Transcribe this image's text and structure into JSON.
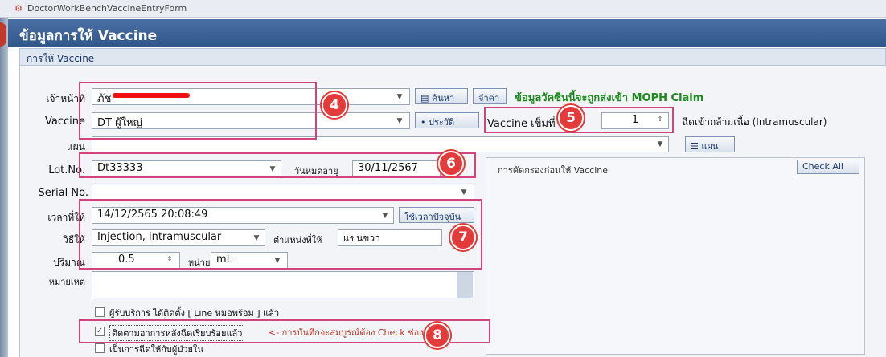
{
  "window": {
    "title": "DoctorWorkBenchVaccineEntryForm"
  },
  "header": {
    "title": "ข้อมูลการให้ Vaccine"
  },
  "section": {
    "title": "การให้ Vaccine"
  },
  "form": {
    "officer_label": "เจ้าหน้าที่",
    "officer_value": "ภัช",
    "search_button": "ค้นหา",
    "remember_button": "จำค่า",
    "moph_note": "ข้อมูลวัคซีนนี้จะถูกส่งเข้า MOPH Claim",
    "vaccine_label": "Vaccine",
    "vaccine_value": "DT ผู้ใหญ่",
    "history_button": "ประวัติ",
    "dose_label": "Vaccine เข็มที่",
    "dose_value": "1",
    "route_note": "ฉีดเข้ากล้ามเนื้อ (Intramuscular)",
    "plan_label": "แผน",
    "plan_button": "แผน",
    "lot_label": "Lot.No.",
    "lot_value": "Dt33333",
    "expiry_label": "วันหมดอายุ",
    "expiry_value": "30/11/2567",
    "serial_label": "Serial No.",
    "given_time_label": "เวลาที่ให้",
    "given_time_value": "14/12/2565 20:08:49",
    "now_button": "ใช้เวลาปัจจุบัน",
    "method_label": "วิธีให้",
    "method_value": "Injection, intramuscular",
    "site_label": "ตำแหน่งที่ให้",
    "site_value": "แขนขวา",
    "amount_label": "ปริมาณ",
    "amount_value": "0.5",
    "unit_label": "หน่วย",
    "unit_value": "mL",
    "remark_label": "หมายเหตุ",
    "check_line": "ผู้รับบริการ ได้ติดตั้ง [ Line หมอพร้อม ] แล้ว",
    "check_follow": "ติดตามอาการหลังฉีดเรียบร้อยแล้ว",
    "check_follow_note": "<- การบันทึกจะสมบูรณ์ต้อง Check ช่องนี้ด้วย",
    "check_inpatient": "เป็นการฉีดให้กับผู้ป่วยใน"
  },
  "screening": {
    "title": "การคัดกรองก่อนให้ Vaccine",
    "check_all": "Check All"
  },
  "badges": {
    "b4": "4",
    "b5": "5",
    "b6": "6",
    "b7": "7",
    "b8": "8"
  },
  "colors": {
    "header": "#2f5689",
    "highlight": "#d0457d",
    "badge": "#e33a3a",
    "moph_green": "#1b8a1b"
  },
  "icons": {
    "app": "app-icon",
    "dropdown": "chevron-down-icon",
    "spinner": "spinner-icon",
    "list": "list-icon",
    "search": "search-icon",
    "history": "history-icon"
  }
}
